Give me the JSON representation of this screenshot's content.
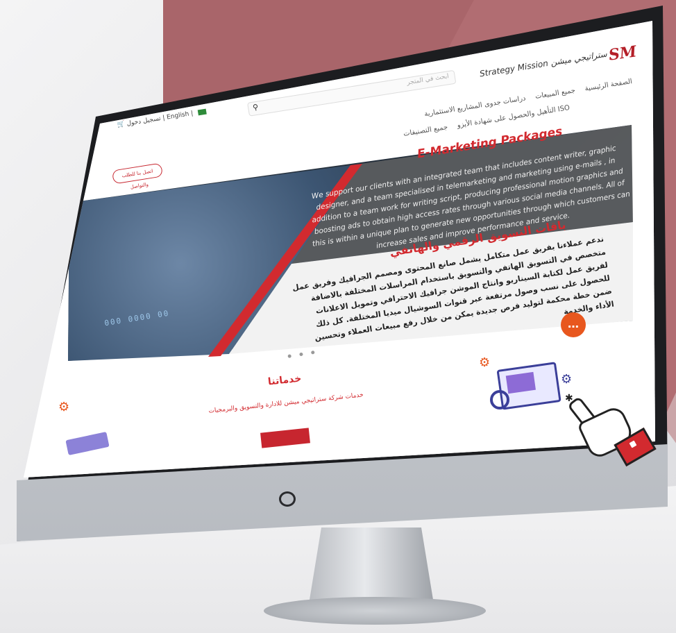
{
  "header": {
    "logo_mark": "SM",
    "logo_text": "Strategy Mission ستراتيجي ميشن",
    "search_placeholder": "ابحث في المتجر",
    "nav_row1": [
      "الصفحة الرئيسية",
      "جميع المبيعات",
      "دراسات جدوى المشاريع الاستثمارية"
    ],
    "nav_row2": [
      "التأهيل والحصول على شهادة الأيزو ISO",
      "جميع التصنيفات"
    ],
    "topbar_login": "تسجيل دخول",
    "topbar_lang": "English",
    "quote_button": "اتصل بنا للطلب والتواصل"
  },
  "hero": {
    "title_en": "E-Marketing Packages",
    "body_en": "We support our clients with an integrated team that includes content writer, graphic designer, and a team specialised in telemarketing and marketing using e-mails , in addition to a team work for writing script, producing professional motion graphics and boosting ads to obtain high access rates through various social media channels. All of this is within a unique plan to generate new opportunities through which customers can increase sales and improve performance and service.",
    "title_ar": "باقات التسويق الرقمي والهاتفي",
    "body_ar": "ندعم عملاءنا بفريق عمل متكامل يشمل صانع المحتوى ومصمم الجرافيك وفريق عمل متخصص في التسويق الهاتفي والتسويق باستخدام المراسلات المختلفة بالاضافة لفريق عمل لكتابة السيناريو وانتاج الموشن جرافيك الاحترافي وتمويل الاعلانات للحصول على نسب وصول مرتفعة عبر قنوات السوشيال ميديا المختلفة. كل ذلك ضمن خطة محكمة لتوليد فرص جديدة يمكن من خلال رفع مبيعات العملاء وتحسين الأداء والخدمة"
  },
  "services": {
    "title": "خدماتنا",
    "subtitle": "خدمات شركة ستراتيجي ميشن للادارة والتسويق والبرمجيات"
  },
  "colors": {
    "accent": "#d22a2f",
    "backdrop": "#a9656a",
    "bezel": "#1c1d20"
  },
  "icons": [
    "search-icon",
    "cart-icon",
    "flag-icon",
    "chat-icon",
    "gear-icon",
    "hand-cursor-icon",
    "power-icon"
  ]
}
